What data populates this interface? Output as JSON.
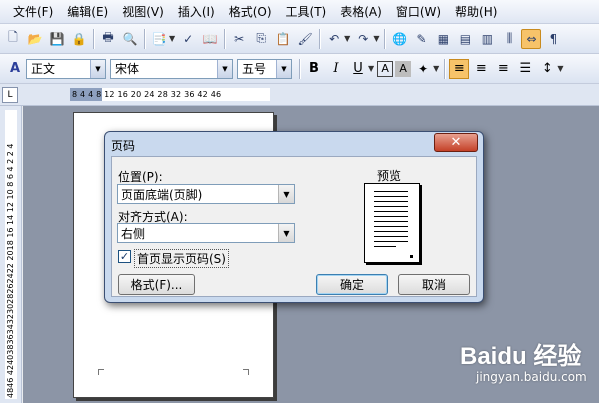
{
  "menu": [
    "文件(F)",
    "编辑(E)",
    "视图(V)",
    "插入(I)",
    "格式(O)",
    "工具(T)",
    "表格(A)",
    "窗口(W)",
    "帮助(H)"
  ],
  "formatting": {
    "style": "正文",
    "font": "宋体",
    "size": "五号",
    "bold": "B",
    "italic": "I",
    "underline": "U",
    "char_border": "A",
    "char_shading": "A"
  },
  "ruler": {
    "corner": "L",
    "h_numbers": "8  4       4   8  12  16  20  24  28  32  36    42 46",
    "v_numbers": "4846   4240383634323028262422 2018 16 14 12 10 8  6  4  2     2  4"
  },
  "dialog": {
    "title": "页码",
    "close": "✕",
    "position_label": "位置(P):",
    "position_value": "页面底端(页脚)",
    "align_label": "对齐方式(A):",
    "align_value": "右侧",
    "first_page_label": "首页显示页码(S)",
    "first_page_checked": "✓",
    "preview_label": "预览",
    "format_button": "格式(F)...",
    "ok_button": "确定",
    "cancel_button": "取消"
  },
  "watermark": {
    "logo": "Baidu 经验",
    "url": "jingyan.baidu.com"
  }
}
